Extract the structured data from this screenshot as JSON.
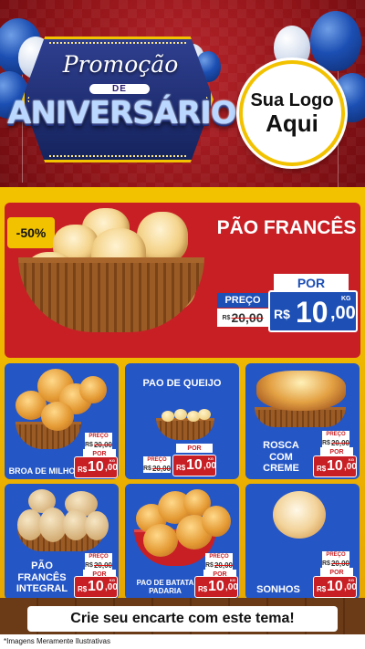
{
  "header": {
    "promo_title": "Promoção",
    "promo_de": "DE",
    "promo_main": "ANIVERSÁRIO",
    "logo_line1": "Sua Logo",
    "logo_line2": "Aqui"
  },
  "hero": {
    "discount": "-50%",
    "title": "PÃO FRANCÊS",
    "por_label": "POR",
    "preco_label": "PREÇO",
    "old_currency": "R$",
    "old_price": "20,00",
    "currency": "R$",
    "price_int": "10",
    "price_dec": ",00",
    "unit": "KG"
  },
  "products": [
    {
      "title": "BROA DE MILHO",
      "preco_label": "PREÇO",
      "old_currency": "R$",
      "old_price": "20,00",
      "por_label": "POR",
      "currency": "R$",
      "price_int": "10",
      "price_dec": ",00",
      "unit": "KG"
    },
    {
      "title": "PAO DE QUEIJO",
      "preco_label": "PREÇO",
      "old_currency": "R$",
      "old_price": "20,00",
      "por_label": "POR",
      "currency": "R$",
      "price_int": "10",
      "price_dec": ",00",
      "unit": "KG"
    },
    {
      "title": "ROSCA COM CREME",
      "title_l1": "ROSCA",
      "title_l2": "COM",
      "title_l3": "CREME",
      "preco_label": "PREÇO",
      "old_currency": "R$",
      "old_price": "20,00",
      "por_label": "POR",
      "currency": "R$",
      "price_int": "10",
      "price_dec": ",00",
      "unit": "KG"
    },
    {
      "title": "PÃO FRANCÊS INTEGRAL",
      "title_l1": "PÃO",
      "title_l2": "FRANCÊS",
      "title_l3": "INTEGRAL",
      "preco_label": "PREÇO",
      "old_currency": "R$",
      "old_price": "20,00",
      "por_label": "POR",
      "currency": "R$",
      "price_int": "10",
      "price_dec": ",00",
      "unit": "KG"
    },
    {
      "title": "PAO DE BATATA PADARIA",
      "title_l1": "PAO DE BATATA",
      "title_l2": "PADARIA",
      "preco_label": "PREÇO",
      "old_currency": "R$",
      "old_price": "20,00",
      "por_label": "POR",
      "currency": "R$",
      "price_int": "10",
      "price_dec": ",00",
      "unit": "KG"
    },
    {
      "title": "SONHOS",
      "preco_label": "PREÇO",
      "old_currency": "R$",
      "old_price": "20,00",
      "por_label": "POR",
      "currency": "R$",
      "price_int": "10",
      "price_dec": ",00",
      "unit": "KG"
    }
  ],
  "cta": "Crie seu encarte com este tema!",
  "footer": "*Imagens Meramente Ilustrativas",
  "colors": {
    "background_red": "#8f1418",
    "panel_red": "#c81f25",
    "card_blue": "#2456c6",
    "accent_yellow": "#f2c200"
  }
}
